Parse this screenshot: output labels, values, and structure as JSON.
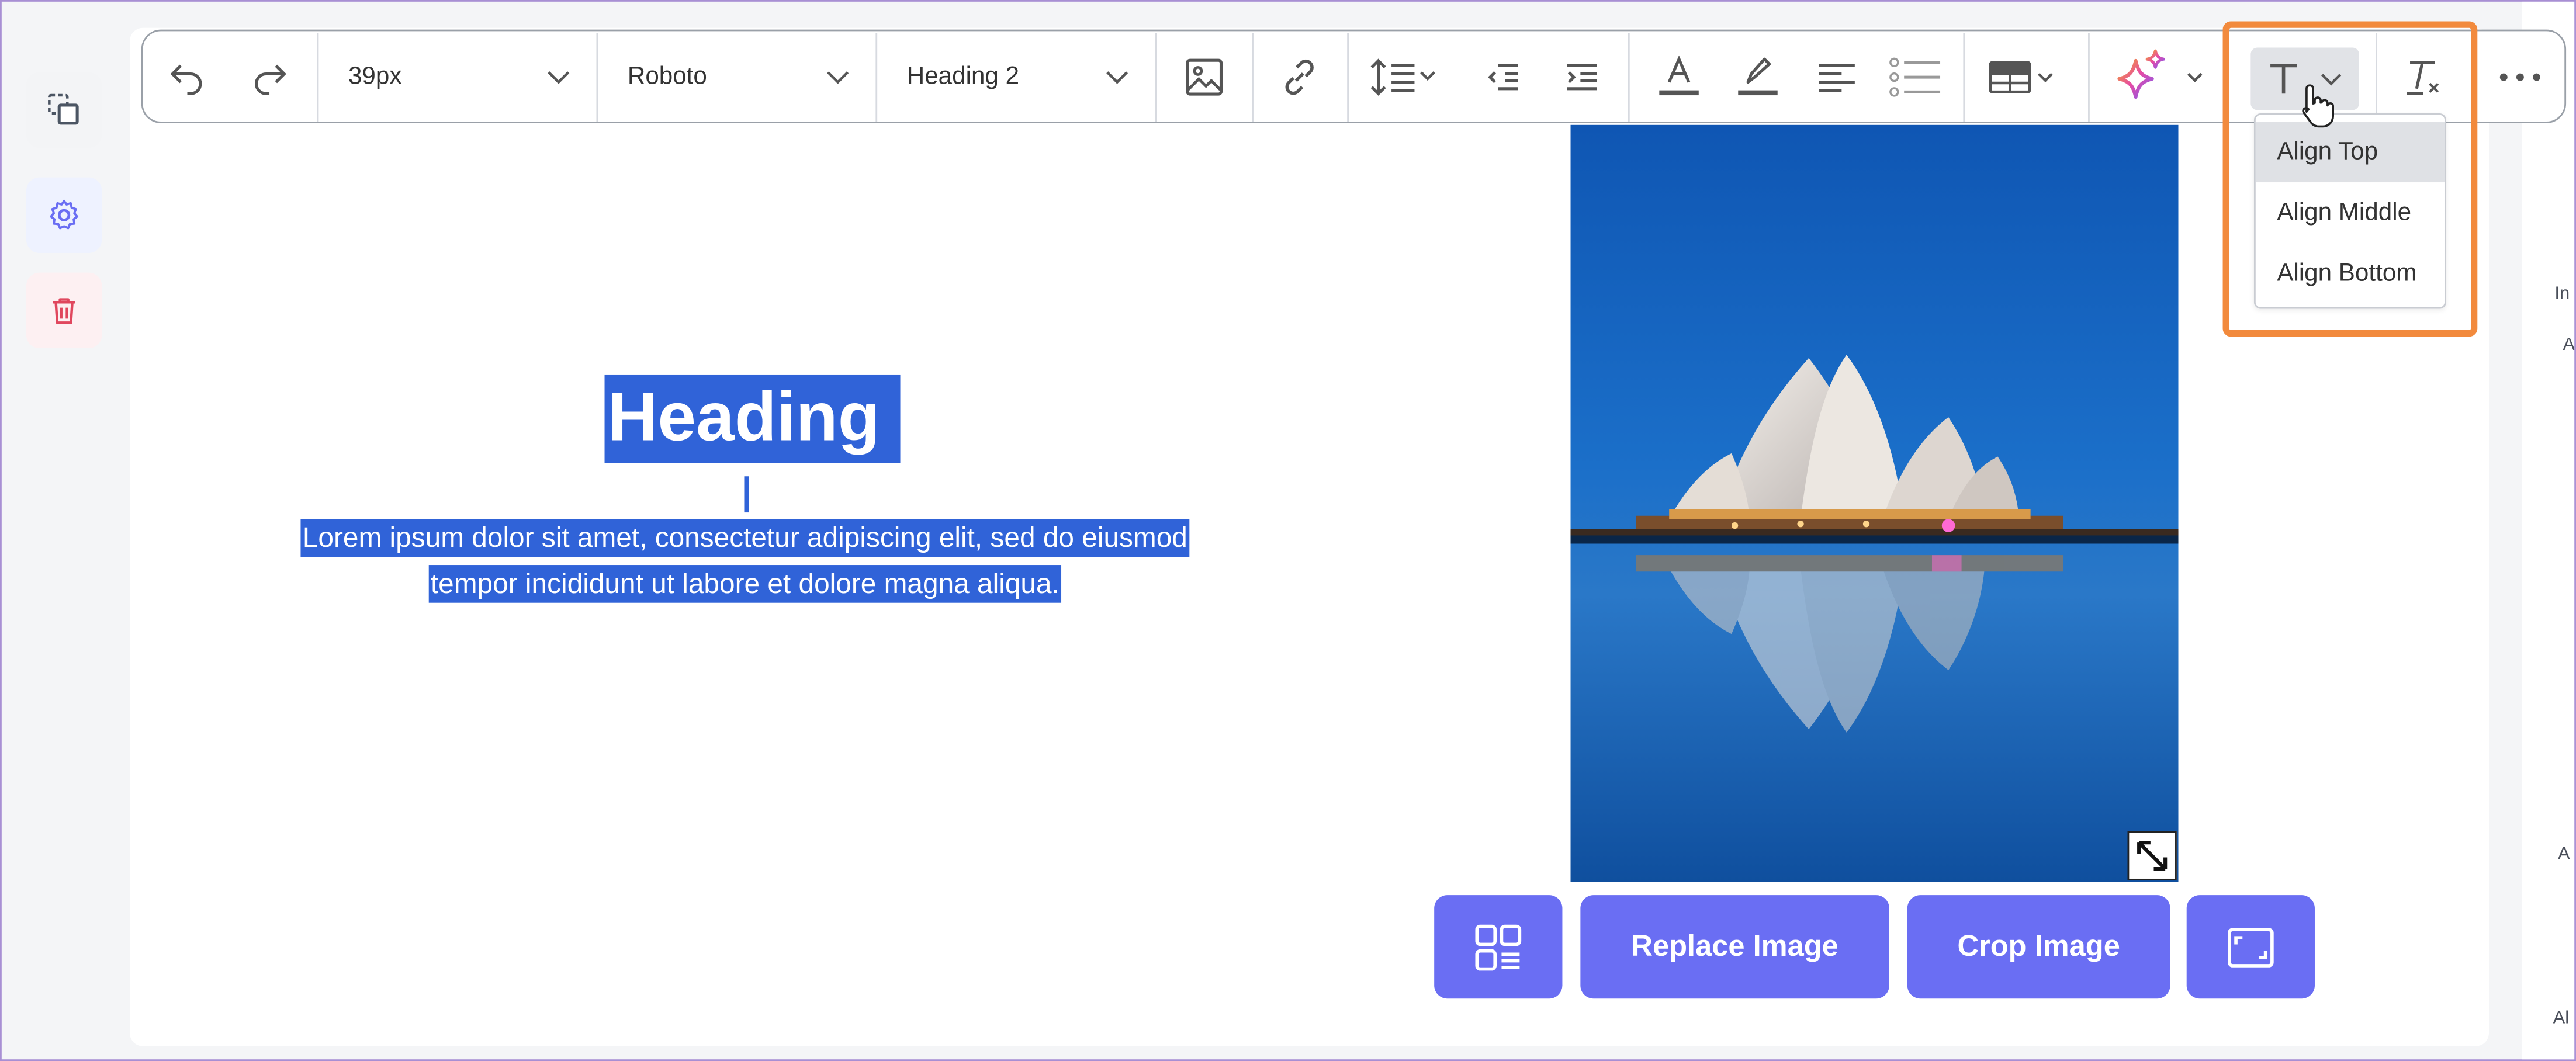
{
  "toolbar": {
    "font_size": "39px",
    "font_family": "Roboto",
    "block_style": "Heading 2"
  },
  "valign_menu": {
    "items": [
      "Align Top",
      "Align Middle",
      "Align Bottom"
    ],
    "hovered": "Align Top"
  },
  "content": {
    "heading": "Heading",
    "paragraph_line1": "Lorem ipsum dolor sit amet, consectetur adipiscing elit, sed do eiusmod",
    "paragraph_line2": "tempor incididunt ut labore et dolore magna aliqua."
  },
  "image_actions": {
    "replace": "Replace Image",
    "crop": "Crop Image"
  },
  "right_panel_fragments": [
    "In",
    "A",
    "A",
    "Al"
  ],
  "colors": {
    "accent": "#6a6ef3",
    "selection": "#3063d8",
    "highlight_box": "#f28a3d",
    "delete": "#e0475e"
  },
  "icons": [
    "copy-select-icon",
    "gear-icon",
    "trash-icon",
    "undo-icon",
    "redo-icon",
    "image-icon",
    "link-icon",
    "line-height-icon",
    "outdent-icon",
    "indent-icon",
    "text-color-icon",
    "highlighter-icon",
    "align-left-icon",
    "list-icon",
    "table-icon",
    "ai-sparkle-icon",
    "vertical-align-icon",
    "clear-format-icon",
    "more-icon",
    "pointer-hand-icon",
    "layout-icon",
    "expand-icon",
    "fit-frame-icon"
  ]
}
